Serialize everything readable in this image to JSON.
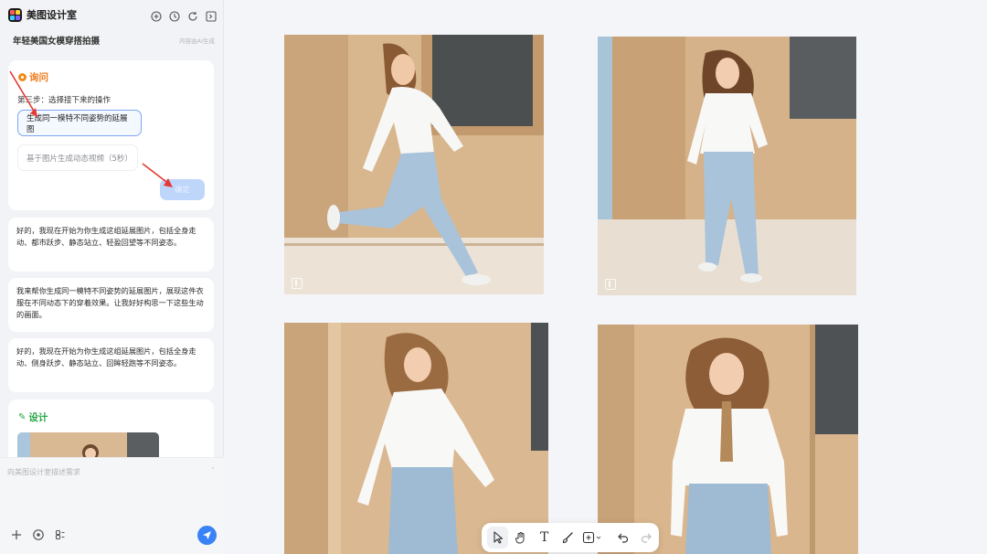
{
  "app": {
    "title": "美图设计室"
  },
  "session": {
    "title": "年轻美国女模穿搭拍摄",
    "note": "内容由AI生成"
  },
  "ask_card": {
    "label": "询问",
    "step_text": "第三步：选择接下来的操作",
    "options": [
      "生成同一模特不同姿势的延展图",
      "基于图片生成动态视频（5秒）"
    ],
    "confirm_label": "确定"
  },
  "messages": [
    "好的，我现在开始为你生成这组延展图片，包括全身走动、都市跃步、静态站立、轻盈回望等不同姿态。",
    "我来帮你生成同一模特不同姿势的延展图片，展现这件衣服在不同动态下的穿着效果。让我好好构思一下这些生动的画面。",
    "好的，我现在开始为你生成这组延展图片，包括全身走动、侧身跃步、静态站立、回眸轻跑等不同姿态。"
  ],
  "design_card": {
    "label": "设计",
    "icon": "sparkle-icon"
  },
  "input": {
    "placeholder": "向美图设计室描述需求"
  },
  "toolbar": {
    "tools": [
      "pointer-icon",
      "hand-icon",
      "text-icon",
      "brush-icon",
      "add-frame-icon",
      "undo-icon",
      "redo-icon"
    ]
  },
  "colors": {
    "accent": "#3a82f7",
    "ask_orange": "#f07a1c",
    "design_green": "#27a848"
  }
}
